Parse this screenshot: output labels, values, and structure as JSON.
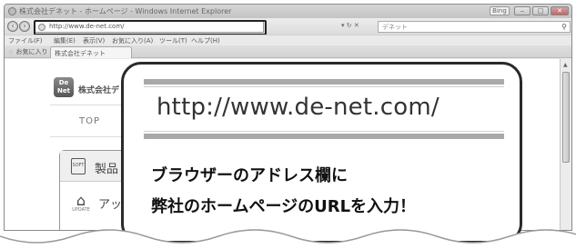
{
  "window": {
    "title": "株式会社デネット - ホームページ - Windows Internet Explorer",
    "search_engine": "Bing",
    "controls": {
      "minimize": "‒",
      "maximize": "□",
      "close": "✕"
    }
  },
  "navbar": {
    "back": "‹",
    "forward": "›",
    "address_value": "http://www.de-net.com/",
    "address_controls": "▾ ↻ ✕",
    "search_placeholder": "デネット",
    "search_icon": "⚲"
  },
  "menu": [
    "ファイル(F)",
    "編集(E)",
    "表示(V)",
    "お気に入り(A)",
    "ツール(T)",
    "ヘルプ(H)"
  ],
  "favorites": {
    "label": "お気に入り",
    "tab_title": "株式会社デネット"
  },
  "site": {
    "logo_text": "De Net",
    "company_name": "株式会社デ",
    "nav_top": "TOP",
    "panel": {
      "item1_label": "製品",
      "item1_icon": "product-icon",
      "item1_icon_text": "SOFT",
      "item2_label": "アッ",
      "item2_icon": "update-icon",
      "item2_icon_text": "UPDATE"
    }
  },
  "callout": {
    "url": "http://www.de-net.com/",
    "line1": "ブラウザーのアドレス欄に",
    "line2": "弊社のホームページのURLを入力！"
  },
  "colors": {
    "chrome_bg": "#e9e9e9",
    "callout_border": "#2a2a2a",
    "url_band": "#a9a9a9"
  }
}
